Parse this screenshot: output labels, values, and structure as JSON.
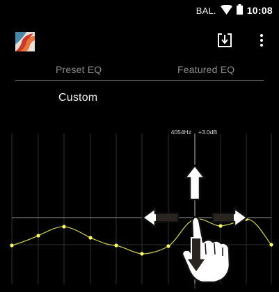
{
  "status_bar": {
    "carrier": "BAL.",
    "time": "10:08",
    "icons": [
      "wifi-icon",
      "battery-icon"
    ]
  },
  "toolbar": {
    "logo": "app-logo-icon",
    "save_icon": "save-download-icon",
    "menu_icon": "overflow-menu-icon"
  },
  "tabs": [
    {
      "label": "Preset EQ"
    },
    {
      "label": "Featured EQ"
    }
  ],
  "preset": {
    "current": "Custom"
  },
  "eq": {
    "selected_frequency": "4054Hz",
    "selected_gain": "+3.0dB",
    "band_count": 11,
    "curve_color": "#c8c84a",
    "point_color": "#ffff66",
    "gesture_icons": [
      "arrow-up-icon",
      "arrow-left-icon",
      "arrow-right-icon",
      "arrow-down-icon",
      "hand-pointer-icon"
    ]
  },
  "colors": {
    "background": "#000000",
    "tab_text": "#8c8c8c",
    "text": "#ffffff"
  }
}
